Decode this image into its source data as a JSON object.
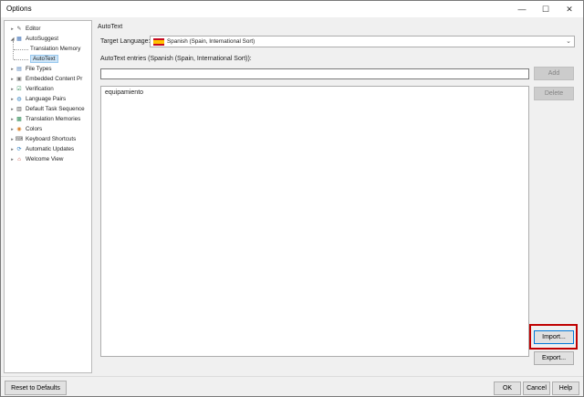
{
  "window": {
    "title": "Options",
    "controls": {
      "minimize": "—",
      "maximize": "☐",
      "close": "✕"
    }
  },
  "tree": {
    "items": [
      {
        "label": "Editor",
        "icon": "pencil-icon",
        "glyph": "✎",
        "color": "#555555",
        "expander": "▸"
      },
      {
        "label": "AutoSuggest",
        "icon": "autosuggest-icon",
        "glyph": "▦",
        "color": "#3c6eb4",
        "expander": "◢"
      },
      {
        "label": "Translation Memory",
        "icon": "",
        "glyph": "",
        "color": "",
        "expander": ""
      },
      {
        "label": "AutoText",
        "icon": "",
        "glyph": "",
        "color": "",
        "expander": "",
        "selected": true
      },
      {
        "label": "File Types",
        "icon": "file-types-icon",
        "glyph": "▤",
        "color": "#4a7bb7",
        "expander": "▸"
      },
      {
        "label": "Embedded Content Pr",
        "icon": "embedded-content-icon",
        "glyph": "▣",
        "color": "#777777",
        "expander": "▸"
      },
      {
        "label": "Verification",
        "icon": "verification-icon",
        "glyph": "☑",
        "color": "#2e8b57",
        "expander": "▸"
      },
      {
        "label": "Language Pairs",
        "icon": "language-pairs-icon",
        "glyph": "◍",
        "color": "#2f7fc1",
        "expander": "▸"
      },
      {
        "label": "Default Task Sequence",
        "icon": "task-sequence-icon",
        "glyph": "▥",
        "color": "#4b4b4b",
        "expander": "▸"
      },
      {
        "label": "Translation Memories",
        "icon": "translation-memories-icon",
        "glyph": "▩",
        "color": "#2e8b57",
        "expander": "▸"
      },
      {
        "label": "Colors",
        "icon": "colors-icon",
        "glyph": "◉",
        "color": "#d9822b",
        "expander": "▸"
      },
      {
        "label": "Keyboard Shortcuts",
        "icon": "keyboard-icon",
        "glyph": "⌨",
        "color": "#555555",
        "expander": "▸"
      },
      {
        "label": "Automatic Updates",
        "icon": "updates-icon",
        "glyph": "⟳",
        "color": "#2f7fc1",
        "expander": "▸"
      },
      {
        "label": "Welcome View",
        "icon": "home-icon",
        "glyph": "⌂",
        "color": "#c0392b",
        "expander": "▸"
      }
    ]
  },
  "panel": {
    "title": "AutoText",
    "target_language_label": "Target Language:",
    "target_language_value": "Spanish (Spain, International Sort)",
    "combo_arrow": "⌄",
    "entries_label": "AutoText entries (Spanish (Spain, International Sort)):",
    "entry_input_value": "",
    "entries": [
      "equipamiento"
    ]
  },
  "buttons": {
    "add": "Add",
    "delete": "Delete",
    "import": "Import...",
    "export": "Export...",
    "reset": "Reset to Defaults",
    "ok": "OK",
    "cancel": "Cancel",
    "help": "Help"
  },
  "colors": {
    "highlight": "#c00000",
    "selection": "#cce4f7",
    "focus": "#0078d7"
  }
}
